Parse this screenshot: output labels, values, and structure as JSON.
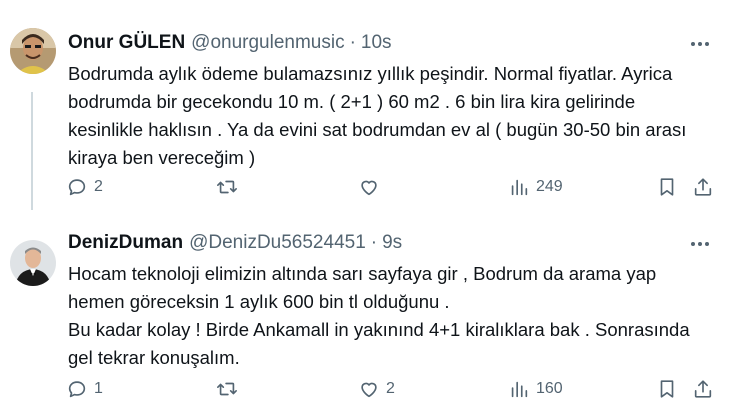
{
  "tweets": [
    {
      "author_name": "Onur GÜLEN",
      "handle": "@onurgulenmusic",
      "separator": "·",
      "time": "10s",
      "body_lines": [
        "Bodrumda aylık ödeme bulamazsınız yıllık peşindir. Normal fiyatlar. Ayrica bodrumda bir gecekondu 10 m. ( 2+1 ) 60 m2 . 6 bin lira kira gelirinde kesinlikle haklısın . Ya da evini sat bodrumdan ev al ( bugün 30-50 bin arası kiraya ben vereceğim )"
      ],
      "replies": "2",
      "retweets": "",
      "likes": "",
      "views": "249"
    },
    {
      "author_name": "DenizDuman",
      "handle": "@DenizDu56524451",
      "separator": "·",
      "time": "9s",
      "body_lines": [
        "Hocam teknoloji elimizin altında sarı sayfaya gir , Bodrum da arama yap hemen göreceksin 1 aylık 600 bin tl olduğunu .",
        "Bu kadar kolay ! Birde Ankamall in yakınınd 4+1 kiralıklara bak . Sonrasında gel tekrar konuşalım."
      ],
      "replies": "1",
      "retweets": "",
      "likes": "2",
      "views": "160"
    }
  ],
  "colors": {
    "text": "#0f1419",
    "secondary": "#536471",
    "thread_line": "#cfd9de"
  },
  "icons": [
    "more-icon",
    "reply-icon",
    "retweet-icon",
    "like-icon",
    "views-icon",
    "bookmark-icon",
    "share-icon"
  ]
}
